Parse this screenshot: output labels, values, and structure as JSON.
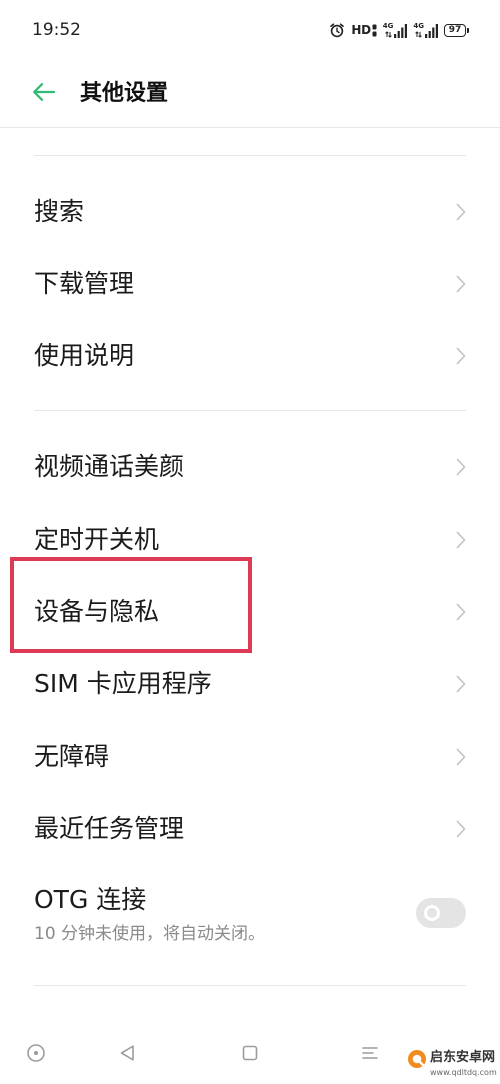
{
  "status_bar": {
    "time": "19:52",
    "hd_label": "HD",
    "sim1_network": "4G",
    "sim2_network": "4G",
    "battery_level": "97",
    "icons": [
      "alarm-icon",
      "hd-voice-icon",
      "signal-icon",
      "signal-icon",
      "battery-icon"
    ]
  },
  "header": {
    "back_icon": "arrow-left-icon",
    "title": "其他设置"
  },
  "sections": [
    {
      "items": [
        {
          "label": "搜索"
        },
        {
          "label": "下载管理"
        },
        {
          "label": "使用说明"
        }
      ]
    },
    {
      "items": [
        {
          "label": "视频通话美颜"
        },
        {
          "label": "定时开关机"
        },
        {
          "label": "设备与隐私"
        },
        {
          "label": "SIM 卡应用程序"
        },
        {
          "label": "无障碍"
        },
        {
          "label": "最近任务管理"
        }
      ]
    }
  ],
  "otg": {
    "label": "OTG 连接",
    "subtitle": "10 分钟未使用，将自动关闭。",
    "enabled": false
  },
  "nav_bar": {
    "icons": [
      "nav-hide-icon",
      "nav-back-icon",
      "nav-home-icon",
      "nav-recents-icon"
    ]
  },
  "watermark": {
    "name": "启东安卓网",
    "url": "www.qdltdq.com"
  },
  "colors": {
    "accent": "#2dbb75",
    "highlight": "#dc3a55",
    "divider": "#e8e8e8",
    "chevron": "#c2c2c2",
    "subtitle": "#8a8a8a",
    "nav_icon": "#9c9c9c",
    "toggle_track": "#e4e4e4",
    "text": "#1b1b1b"
  }
}
